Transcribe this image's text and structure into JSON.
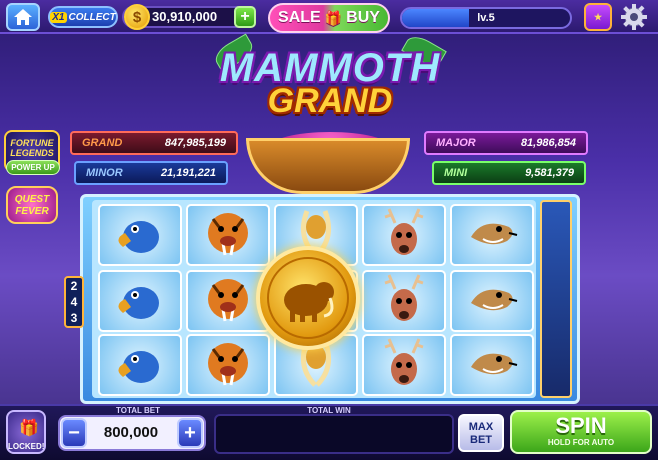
{
  "topbar": {
    "collect": {
      "multiplier": "X1",
      "label": "COLLECT"
    },
    "coins": "30,910,000",
    "sale": {
      "left": "SALE",
      "right": "BUY"
    },
    "level": "lv.5",
    "level_progress": 0.4
  },
  "side": {
    "fortune": "FORTUNE LEGENDS",
    "powerup": "POWER UP",
    "quest": "QUEST FEVER"
  },
  "title": {
    "line1": "MAMMOTH",
    "line2": "GRAND"
  },
  "jackpots": {
    "grand": {
      "label": "GRAND",
      "value": "847,985,199"
    },
    "major": {
      "label": "MAJOR",
      "value": "81,986,854"
    },
    "minor": {
      "label": "MINOR",
      "value": "21,191,221"
    },
    "mini": {
      "label": "MINI",
      "value": "9,581,379"
    }
  },
  "reels": {
    "ways": [
      "2",
      "4",
      "3"
    ],
    "columns": [
      [
        "dodo-bird",
        "dodo-bird",
        "dodo-bird"
      ],
      [
        "sabertooth-tiger",
        "sabertooth-tiger",
        "sabertooth-tiger"
      ],
      [
        "mammoth-tusk",
        "mammoth-coin",
        "mammoth-tusk"
      ],
      [
        "deer",
        "deer",
        "deer"
      ],
      [
        "weasel",
        "weasel",
        "weasel"
      ]
    ]
  },
  "bottombar": {
    "locked": "LOCKED!",
    "total_bet_label": "TOTAL BET",
    "bet_value": "800,000",
    "total_win_label": "TOTAL WIN",
    "max_bet": "MAX BET",
    "spin": "SPIN",
    "spin_sub": "HOLD FOR AUTO"
  },
  "colors": {
    "accent": "#ffd23a",
    "spin": "#3ca61a",
    "bg": "#4a2fa8"
  }
}
